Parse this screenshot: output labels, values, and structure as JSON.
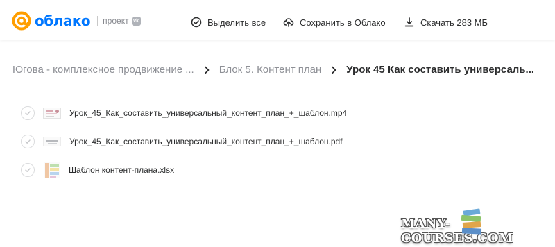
{
  "brand": {
    "name": "облако",
    "subtitle": "проект",
    "badge": "vk",
    "accent": "#0077ff",
    "logo_accent": "#ff9e00"
  },
  "toolbar": {
    "select_all": "Выделить все",
    "save_to_cloud": "Сохранить в Облако",
    "download": "Скачать 283 МБ"
  },
  "breadcrumb": {
    "items": [
      "Югова - комплексное продвижение ...",
      "Блок 5. Контент план"
    ],
    "current": "Урок 45 Как составить универсаль..."
  },
  "files": [
    {
      "name": "Урок_45_Как_составить_универсальный_контент_план_+_шаблон.mp4",
      "type": "video"
    },
    {
      "name": "Урок_45_Как_составить_универсальный_контент_план_+_шаблон.pdf",
      "type": "pdf"
    },
    {
      "name": "Шаблон контент-плана.xlsx",
      "type": "spreadsheet"
    }
  ],
  "watermark": "MANY-COURSES.COM"
}
